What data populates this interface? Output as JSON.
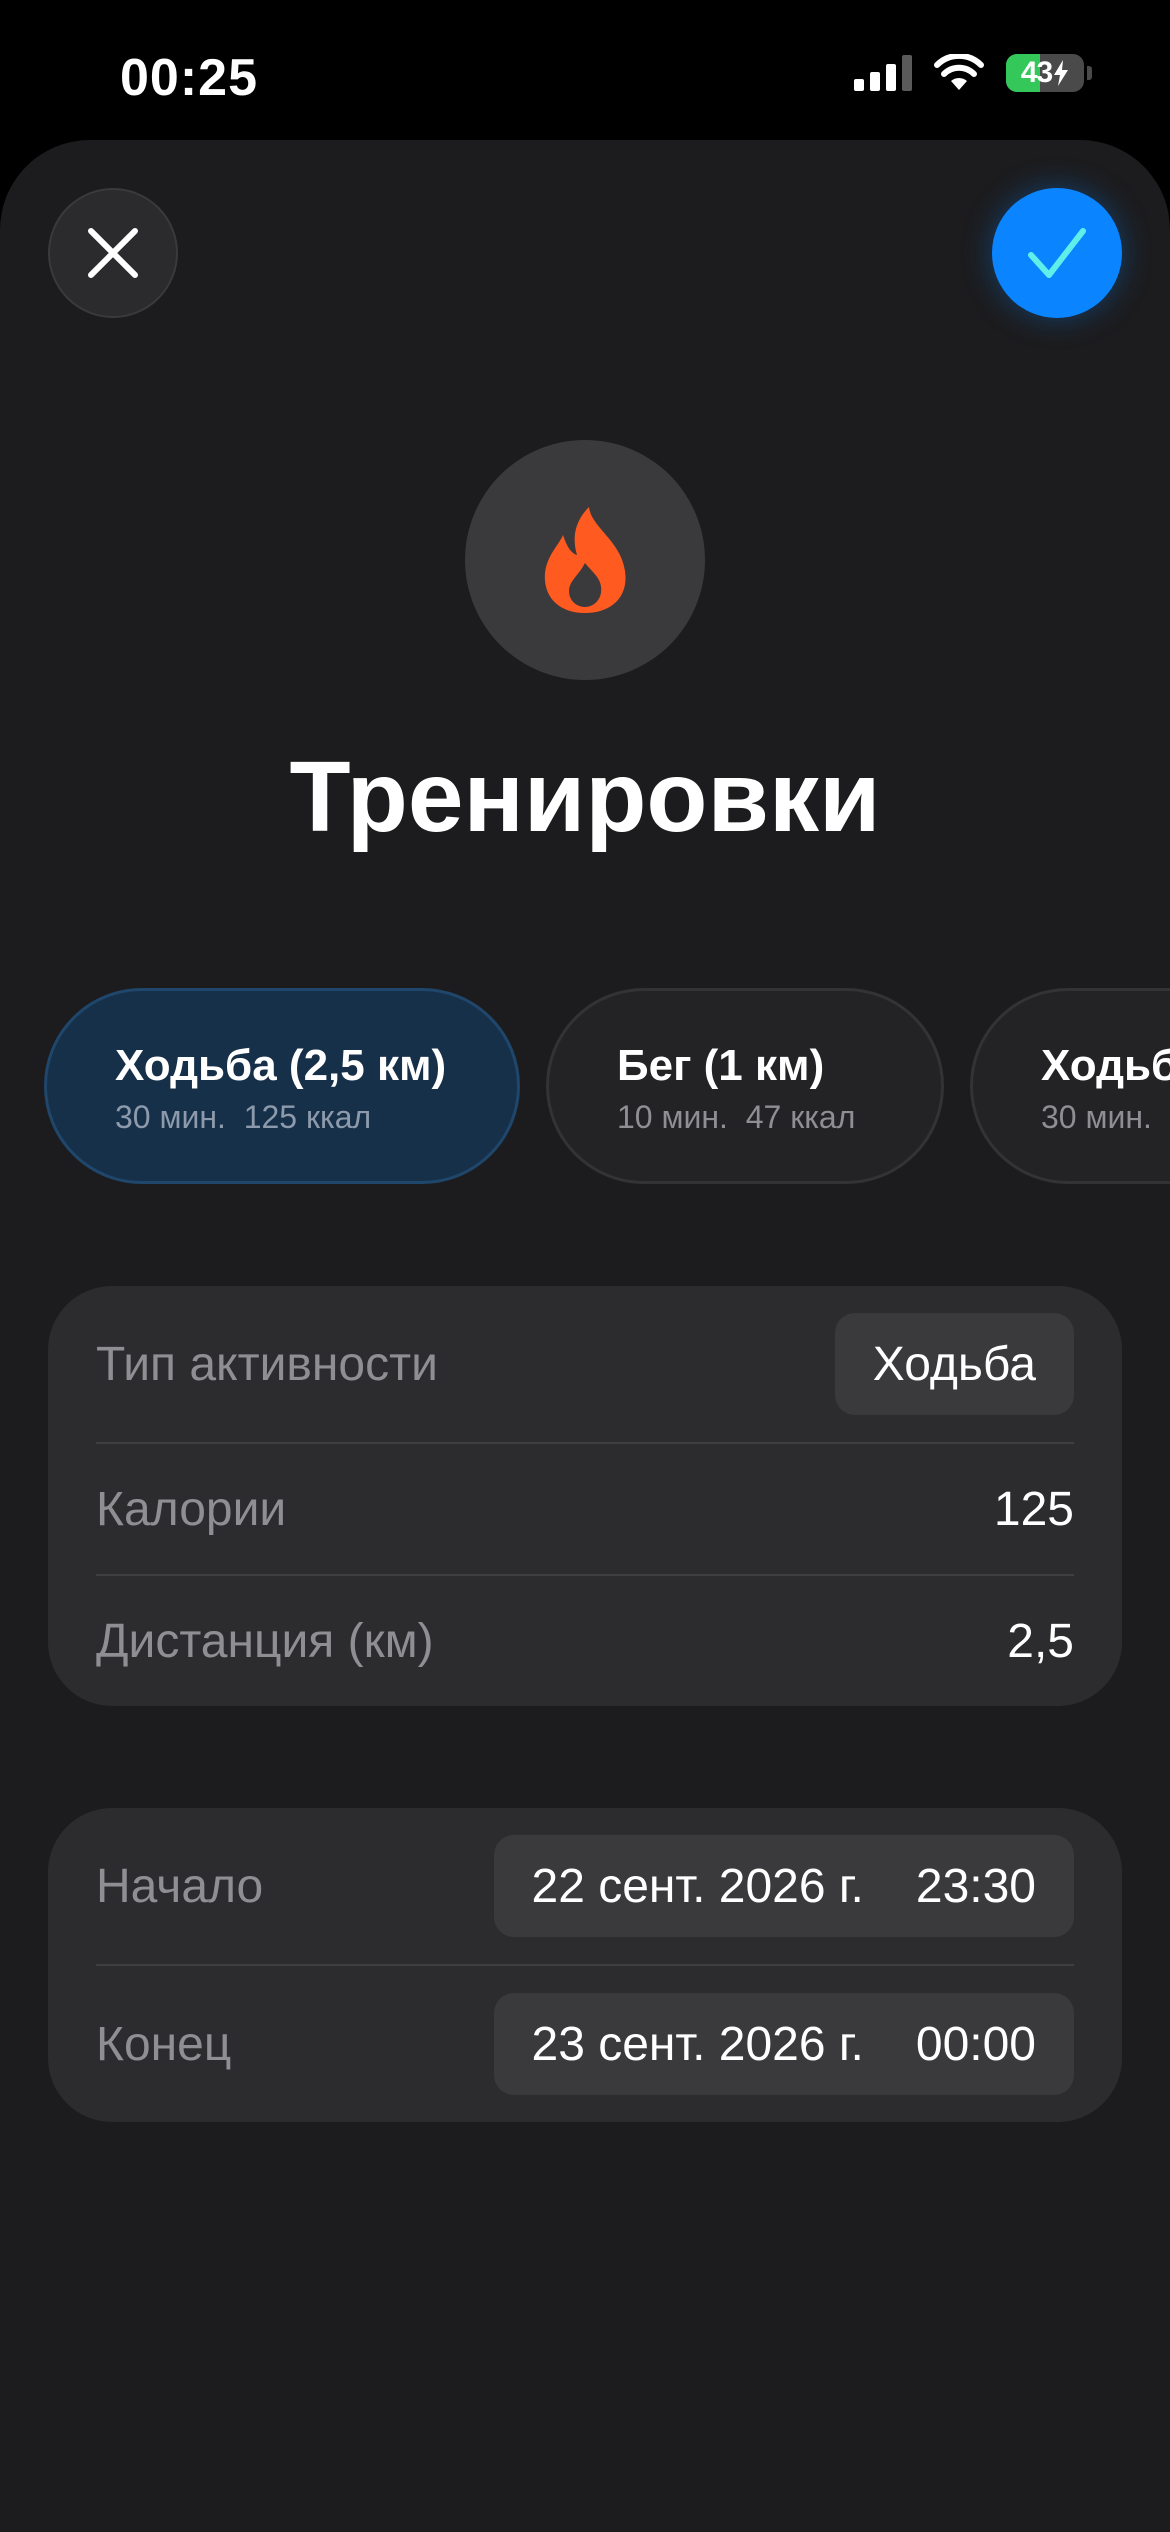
{
  "status_bar": {
    "time": "00:25",
    "battery_level": "43",
    "battery_fraction": 0.43,
    "battery_color": "#34c759"
  },
  "header": {
    "close_icon": "close-icon",
    "confirm_icon": "checkmark-icon",
    "accent_color": "#0a84ff"
  },
  "hero": {
    "icon": "flame-icon",
    "icon_color": "#ff5a1f",
    "title": "Тренировки"
  },
  "presets": [
    {
      "title": "Ходьба (2,5 км)",
      "duration": "30 мин.",
      "calories": "125 ккал",
      "selected": true
    },
    {
      "title": "Бег (1 км)",
      "duration": "10 мин.",
      "calories": "47 ккал",
      "selected": false
    },
    {
      "title": "Ходьба",
      "duration": "30 мин.",
      "calories": "",
      "selected": false
    }
  ],
  "details": {
    "activity_type": {
      "label": "Тип активности",
      "value": "Ходьба"
    },
    "calories": {
      "label": "Калории",
      "value": "125"
    },
    "distance": {
      "label": "Дистанция (км)",
      "value": "2,5"
    }
  },
  "time_range": {
    "start": {
      "label": "Начало",
      "date": "22 сент. 2026 г.",
      "time": "23:30"
    },
    "end": {
      "label": "Конец",
      "date": "23 сент. 2026 г.",
      "time": "00:00"
    }
  }
}
